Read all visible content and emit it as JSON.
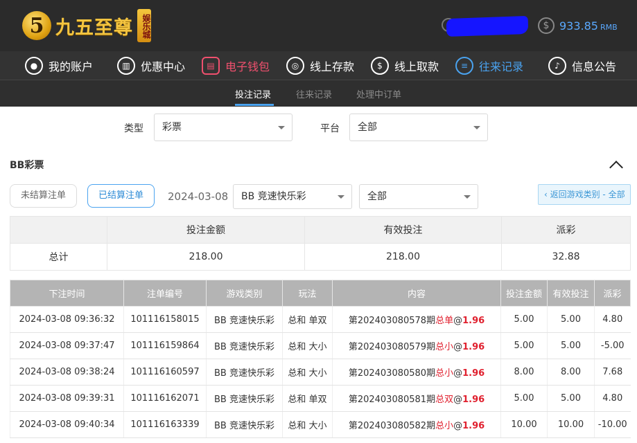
{
  "header": {
    "logo_text": "九五至尊",
    "logo_badge": "娱乐城",
    "logo_digit": "5",
    "balance": "933.85",
    "currency": "RMB"
  },
  "nav": [
    {
      "label": "我的账户",
      "icon": "user-icon"
    },
    {
      "label": "优惠中心",
      "icon": "gift-icon"
    },
    {
      "label": "电子钱包",
      "icon": "wallet-icon"
    },
    {
      "label": "线上存款",
      "icon": "deposit-icon"
    },
    {
      "label": "线上取款",
      "icon": "withdraw-icon"
    },
    {
      "label": "往来记录",
      "icon": "records-icon"
    },
    {
      "label": "信息公告",
      "icon": "bell-icon"
    }
  ],
  "subnav": [
    "投注记录",
    "往来记录",
    "处理中订单"
  ],
  "filters": {
    "type_label": "类型",
    "type_value": "彩票",
    "platform_label": "平台",
    "platform_value": "全部"
  },
  "section": {
    "title": "BB彩票",
    "unsettled_label": "未结算注单",
    "settled_label": "已结算注单",
    "date": "2024-03-08",
    "game_select": "BB 竞速快乐彩",
    "play_select": "全部",
    "back_label": "‹ 返回游戏类别 - 全部"
  },
  "summary": {
    "headers": [
      "",
      "投注金额",
      "有效投注",
      "派彩"
    ],
    "total_label": "总计",
    "bet_amount": "218.00",
    "valid_bet": "218.00",
    "payout": "32.88"
  },
  "table": {
    "headers": [
      "下注时间",
      "注单编号",
      "游戏类别",
      "玩法",
      "内容",
      "投注金额",
      "有效投注",
      "派彩"
    ],
    "rows": [
      {
        "time": "2024-03-08 09:36:32",
        "id": "101116158015",
        "game": "BB 竞速快乐彩",
        "play": "总和 单双",
        "issue": "第202403080578期",
        "pick": "总单",
        "odds": "@1.96",
        "bet": "5.00",
        "valid": "5.00",
        "payout": "4.80",
        "negative": false
      },
      {
        "time": "2024-03-08 09:37:47",
        "id": "101116159864",
        "game": "BB 竞速快乐彩",
        "play": "总和 大小",
        "issue": "第202403080579期",
        "pick": "总小",
        "odds": "@1.96",
        "bet": "5.00",
        "valid": "5.00",
        "payout": "-5.00",
        "negative": true
      },
      {
        "time": "2024-03-08 09:38:24",
        "id": "101116160597",
        "game": "BB 竞速快乐彩",
        "play": "总和 大小",
        "issue": "第202403080580期",
        "pick": "总小",
        "odds": "@1.96",
        "bet": "8.00",
        "valid": "8.00",
        "payout": "7.68",
        "negative": false
      },
      {
        "time": "2024-03-08 09:39:31",
        "id": "101116162071",
        "game": "BB 竞速快乐彩",
        "play": "总和 单双",
        "issue": "第202403080581期",
        "pick": "总双",
        "odds": "@1.96",
        "bet": "5.00",
        "valid": "5.00",
        "payout": "4.80",
        "negative": false
      },
      {
        "time": "2024-03-08 09:40:34",
        "id": "101116163339",
        "game": "BB 竞速快乐彩",
        "play": "总和 大小",
        "issue": "第202403080582期",
        "pick": "总小",
        "odds": "@1.96",
        "bet": "10.00",
        "valid": "10.00",
        "payout": "-10.00",
        "negative": true
      }
    ]
  },
  "colors": {
    "accent_blue": "#4aa3f0",
    "accent_red": "#e0202e",
    "wallet_pink": "#f0506e",
    "header_bg": "#2b2b2b"
  }
}
